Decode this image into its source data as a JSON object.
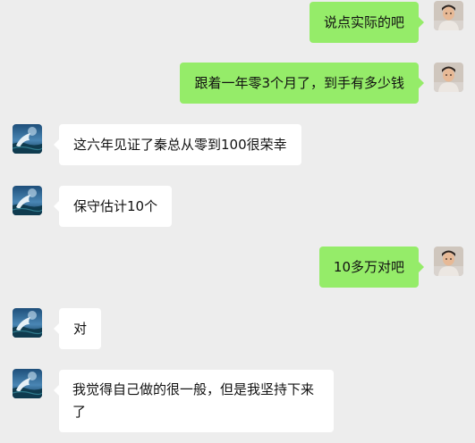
{
  "chat": {
    "messages": [
      {
        "sender": "self",
        "text": "说点实际的吧"
      },
      {
        "sender": "self",
        "text": "跟着一年零3个月了，到手有多少钱"
      },
      {
        "sender": "peer",
        "text": "这六年见证了秦总从零到100很荣幸"
      },
      {
        "sender": "peer",
        "text": "保守估计10个"
      },
      {
        "sender": "self",
        "text": "10多万对吧"
      },
      {
        "sender": "peer",
        "text": "对"
      },
      {
        "sender": "peer",
        "text": "我觉得自己做的很一般，但是我坚持下来了"
      }
    ]
  },
  "colors": {
    "background": "#ededed",
    "self_bubble": "#95ec69",
    "peer_bubble": "#ffffff",
    "text": "#111111"
  },
  "icons": {
    "self_avatar": "person-photo-avatar",
    "peer_avatar": "dolphin-ocean-avatar"
  }
}
